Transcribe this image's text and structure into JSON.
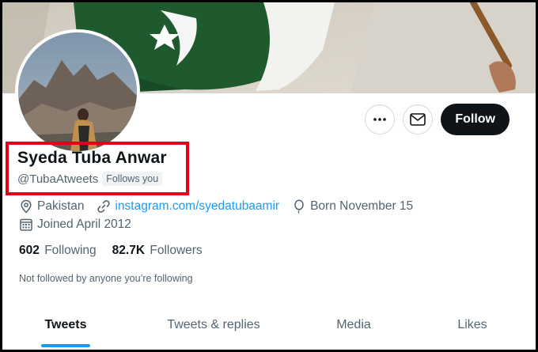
{
  "profile": {
    "display_name": "Syeda Tuba Anwar",
    "handle": "@TubaAtweets",
    "follows_you": "Follows you",
    "location": "Pakistan",
    "website": "instagram.com/syedatubaamir",
    "birthday": "Born November 15",
    "joined": "Joined April 2012",
    "not_followed_note": "Not followed by anyone you’re following"
  },
  "stats": {
    "following_count": "602",
    "following_label": "Following",
    "followers_count": "82.7K",
    "followers_label": "Followers"
  },
  "actions": {
    "follow_label": "Follow",
    "more_icon": "more-icon",
    "message_icon": "envelope-icon"
  },
  "tabs": [
    {
      "label": "Tweets",
      "active": true
    },
    {
      "label": "Tweets & replies",
      "active": false
    },
    {
      "label": "Media",
      "active": false
    },
    {
      "label": "Likes",
      "active": false
    }
  ],
  "colors": {
    "accent": "#1d9bf0",
    "highlight_box": "#e3001b",
    "follow_button": "#0f1419",
    "secondary_text": "#536471"
  }
}
